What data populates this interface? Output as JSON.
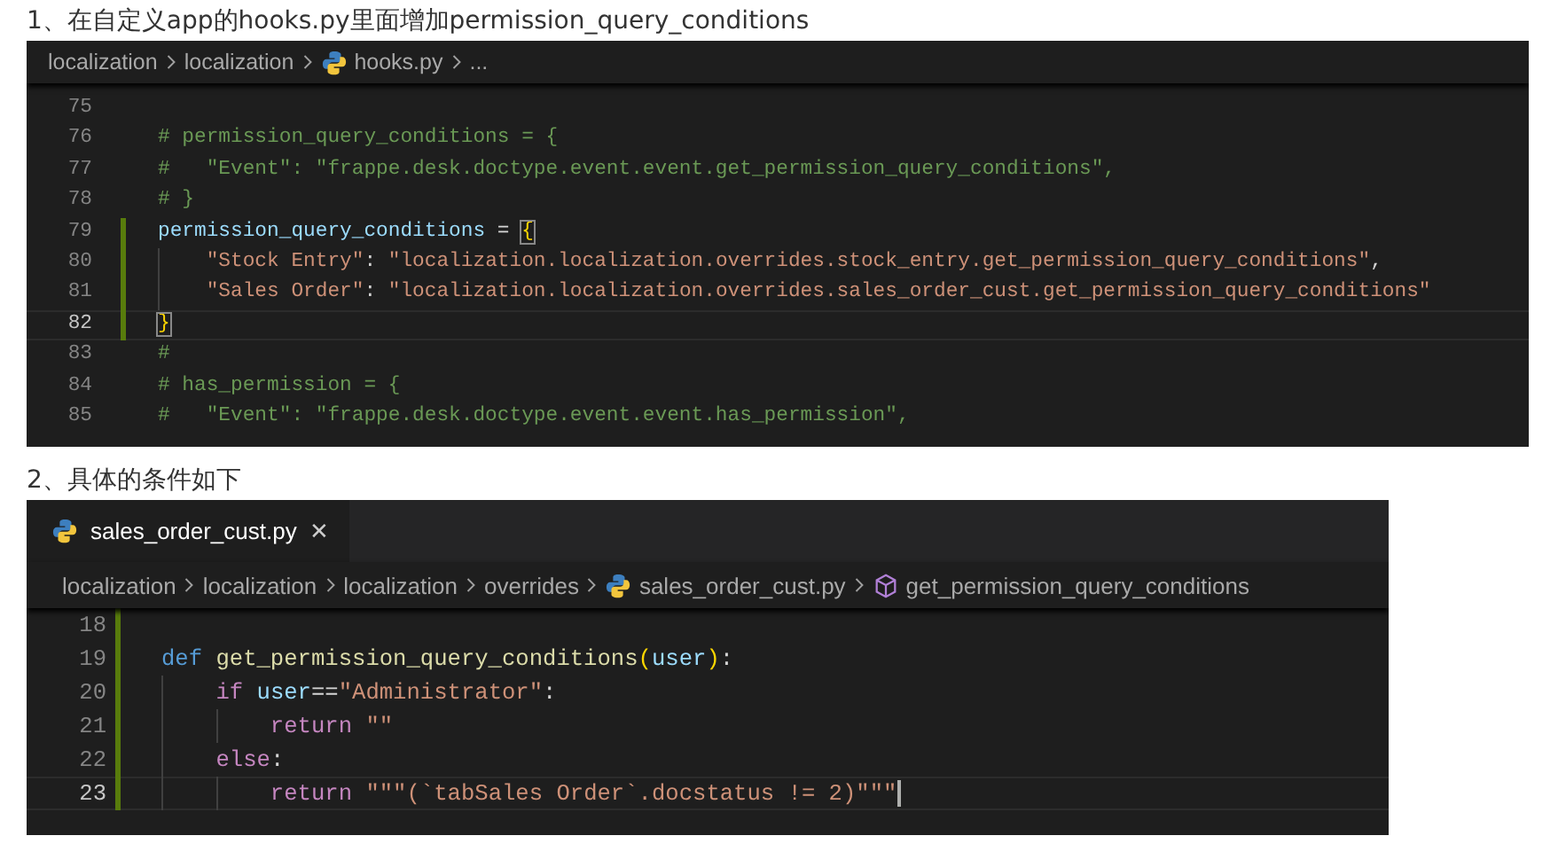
{
  "sections": [
    {
      "heading": "1、在自定义app的hooks.py里面增加permission_query_conditions",
      "editor": {
        "breadcrumb": [
          {
            "text": "localization",
            "kind": "folder"
          },
          {
            "text": "localization",
            "kind": "folder"
          },
          {
            "text": "hooks.py",
            "kind": "python-file"
          },
          {
            "text": "...",
            "kind": "more"
          }
        ],
        "lines": [
          {
            "number": "75",
            "current": false,
            "modified": false,
            "cursor": false
          },
          {
            "number": "76",
            "current": false,
            "modified": false,
            "cursor": false,
            "tokens": [
              {
                "kind": "comment",
                "text": "# permission_query_conditions = {"
              }
            ]
          },
          {
            "number": "77",
            "current": false,
            "modified": false,
            "cursor": false,
            "tokens": [
              {
                "kind": "comment",
                "text": "#   \"Event\": \"frappe.desk.doctype.event.event.get_permission_query_conditions\","
              }
            ]
          },
          {
            "number": "78",
            "current": false,
            "modified": false,
            "cursor": false,
            "tokens": [
              {
                "kind": "comment",
                "text": "# }"
              }
            ]
          },
          {
            "number": "79",
            "current": false,
            "modified": true,
            "cursor": false,
            "tokens": [
              {
                "kind": "variable",
                "text": "permission_query_conditions"
              },
              {
                "kind": "plain",
                "text": " = "
              },
              {
                "kind": "bracket",
                "text": "{"
              }
            ]
          },
          {
            "number": "80",
            "current": false,
            "modified": true,
            "cursor": false,
            "tokens": [
              {
                "kind": "string",
                "text": "    \"Stock Entry\""
              },
              {
                "kind": "plain",
                "text": ": "
              },
              {
                "kind": "string",
                "text": "\"localization.localization.overrides.stock_entry.get_permission_query_conditions\""
              },
              {
                "kind": "plain",
                "text": ","
              }
            ]
          },
          {
            "number": "81",
            "current": false,
            "modified": true,
            "cursor": false,
            "tokens": [
              {
                "kind": "string",
                "text": "    \"Sales Order\""
              },
              {
                "kind": "plain",
                "text": ": "
              },
              {
                "kind": "string",
                "text": "\"localization.localization.overrides.sales_order_cust.get_permission_query_conditions\""
              }
            ]
          },
          {
            "number": "82",
            "current": true,
            "modified": true,
            "cursor": false,
            "tokens": [
              {
                "kind": "bracket",
                "text": "}"
              }
            ]
          },
          {
            "number": "83",
            "current": false,
            "modified": false,
            "cursor": false,
            "tokens": [
              {
                "kind": "comment",
                "text": "#"
              }
            ]
          },
          {
            "number": "84",
            "current": false,
            "modified": false,
            "cursor": false,
            "tokens": [
              {
                "kind": "comment",
                "text": "# has_permission = {"
              }
            ]
          },
          {
            "number": "85",
            "current": false,
            "modified": false,
            "cursor": false,
            "tokens": [
              {
                "kind": "comment",
                "text": "#   \"Event\": \"frappe.desk.doctype.event.event.has_permission\","
              }
            ]
          }
        ]
      }
    },
    {
      "heading": "2、具体的条件如下",
      "editor": {
        "tabs": [
          {
            "label": "sales_order_cust.py",
            "close": "✕",
            "selected": true
          }
        ],
        "breadcrumb": [
          {
            "text": "localization",
            "kind": "folder"
          },
          {
            "text": "localization",
            "kind": "folder"
          },
          {
            "text": "localization",
            "kind": "folder"
          },
          {
            "text": "overrides",
            "kind": "folder"
          },
          {
            "text": "sales_order_cust.py",
            "kind": "python-file"
          },
          {
            "text": "get_permission_query_conditions",
            "kind": "method"
          }
        ],
        "lines": [
          {
            "number": "18",
            "current": false,
            "modified": true,
            "cursor": false
          },
          {
            "number": "19",
            "current": false,
            "modified": true,
            "cursor": false,
            "tokens": [
              {
                "kind": "keyword",
                "text": "def "
              },
              {
                "kind": "function",
                "text": "get_permission_query_conditions"
              },
              {
                "kind": "bracket-plain",
                "text": "("
              },
              {
                "kind": "param",
                "text": "user"
              },
              {
                "kind": "bracket-plain",
                "text": ")"
              },
              {
                "kind": "plain",
                "text": ":"
              }
            ]
          },
          {
            "number": "20",
            "current": false,
            "modified": true,
            "cursor": false,
            "tokens": [
              {
                "kind": "control",
                "text": "    if "
              },
              {
                "kind": "param",
                "text": "user"
              },
              {
                "kind": "plain",
                "text": "=="
              },
              {
                "kind": "string",
                "text": "\"Administrator\""
              },
              {
                "kind": "plain",
                "text": ":"
              }
            ]
          },
          {
            "number": "21",
            "current": false,
            "modified": true,
            "cursor": false,
            "tokens": [
              {
                "kind": "control",
                "text": "        return "
              },
              {
                "kind": "string",
                "text": "\"\""
              }
            ]
          },
          {
            "number": "22",
            "current": false,
            "modified": true,
            "cursor": false,
            "tokens": [
              {
                "kind": "control",
                "text": "    else"
              },
              {
                "kind": "plain",
                "text": ":"
              }
            ]
          },
          {
            "number": "23",
            "current": true,
            "modified": true,
            "cursor": true,
            "tokens": [
              {
                "kind": "control",
                "text": "        return "
              },
              {
                "kind": "string",
                "text": "\"\"\"(`tabSales Order`.docstatus != 2)\"\"\""
              }
            ]
          }
        ]
      }
    }
  ]
}
